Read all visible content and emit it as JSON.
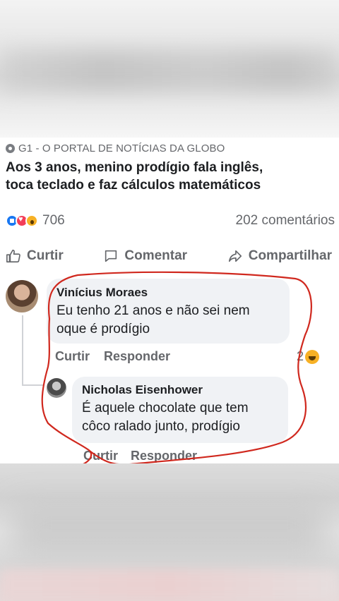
{
  "post": {
    "source": "G1 - O PORTAL DE NOTÍCIAS DA GLOBO",
    "headline_line1": "Aos 3 anos, menino prodígio fala inglês,",
    "headline_line2": "toca teclado e faz cálculos matemáticos",
    "reaction_count": "706",
    "comment_count": "202 comentários",
    "reaction_icons": [
      "like-icon",
      "love-icon",
      "wow-icon"
    ]
  },
  "actions": {
    "like": "Curtir",
    "comment": "Comentar",
    "share": "Compartilhar"
  },
  "comment1": {
    "author": "Vinícius Moraes",
    "text_line1": "Eu tenho 21 anos e não sei nem",
    "text_line2": "oque é prodígio",
    "like": "Curtir",
    "reply": "Responder",
    "reaction_count": "2"
  },
  "comment2": {
    "author": "Nicholas Eisenhower",
    "text_line1": "É aquele chocolate que tem",
    "text_line2": "côco ralado junto, prodígio",
    "like": "Curtir",
    "reply": "Responder"
  },
  "colors": {
    "annotation": "#d0281e",
    "link_blue": "#1877f2",
    "secondary_text": "#65676b"
  }
}
